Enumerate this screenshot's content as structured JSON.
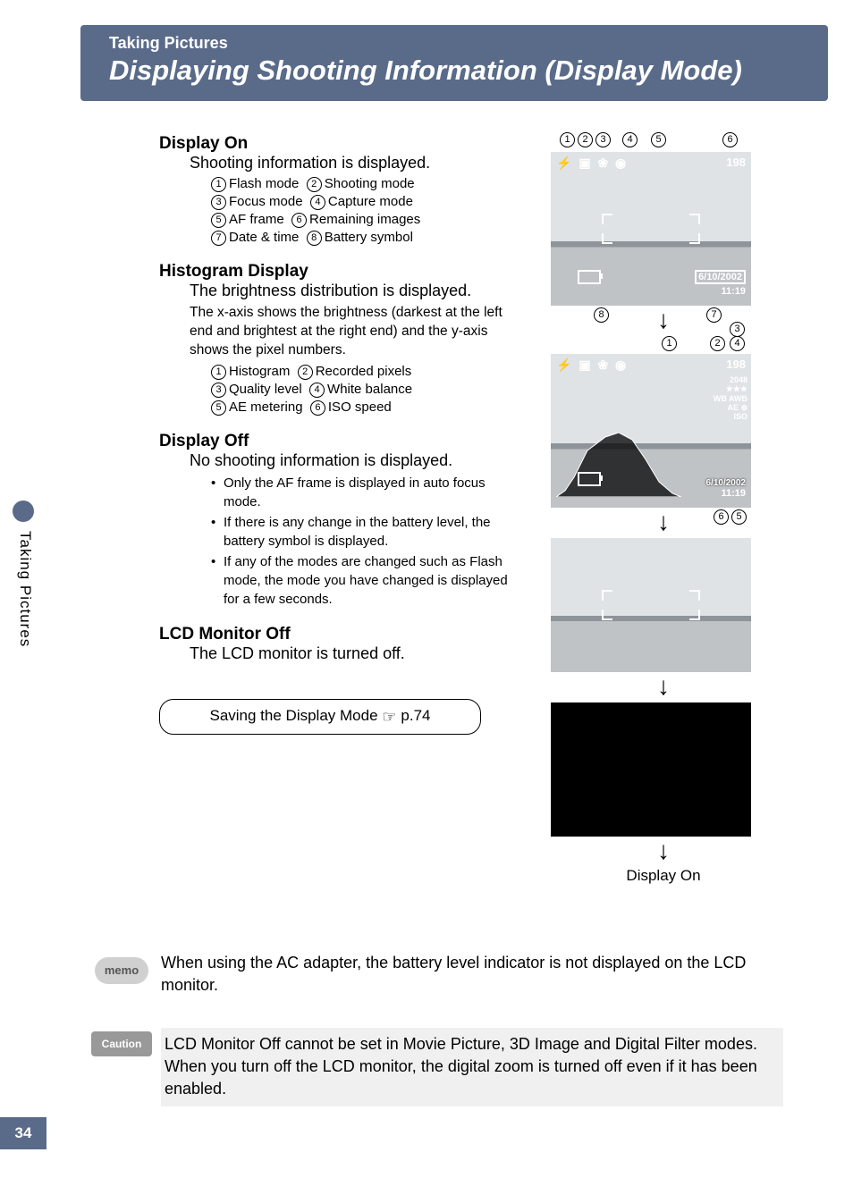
{
  "header": {
    "category": "Taking Pictures",
    "title": "Displaying Shooting Information (Display Mode)"
  },
  "sidebar": {
    "label": "Taking Pictures"
  },
  "page_number": "34",
  "s1": {
    "title": "Display On",
    "lead": "Shooting information is displayed.",
    "items": [
      {
        "n": "1",
        "l": "Flash mode"
      },
      {
        "n": "2",
        "l": "Shooting mode"
      },
      {
        "n": "3",
        "l": "Focus mode"
      },
      {
        "n": "4",
        "l": "Capture mode"
      },
      {
        "n": "5",
        "l": "AF frame"
      },
      {
        "n": "6",
        "l": "Remaining images"
      },
      {
        "n": "7",
        "l": "Date & time"
      },
      {
        "n": "8",
        "l": "Battery symbol"
      }
    ]
  },
  "s2": {
    "title": "Histogram Display",
    "lead": "The brightness distribution is displayed.",
    "body": "The x-axis shows the brightness (darkest at the left end and brightest at the right end) and the y-axis shows the pixel numbers.",
    "items": [
      {
        "n": "1",
        "l": "Histogram"
      },
      {
        "n": "2",
        "l": "Recorded pixels"
      },
      {
        "n": "3",
        "l": "Quality level"
      },
      {
        "n": "4",
        "l": "White balance"
      },
      {
        "n": "5",
        "l": "AE metering"
      },
      {
        "n": "6",
        "l": "ISO speed"
      }
    ]
  },
  "s3": {
    "title": "Display Off",
    "lead": "No shooting information is displayed.",
    "bullets": [
      "Only the AF frame is displayed in auto focus mode.",
      "If there is any change in the battery level, the battery symbol is displayed.",
      "If any of the modes are changed such as  Flash mode, the mode you have changed is displayed for a few seconds."
    ]
  },
  "s4": {
    "title": "LCD Monitor Off",
    "lead": "The LCD monitor is turned off."
  },
  "save": {
    "label": "Saving the Display Mode",
    "ref": "p.74"
  },
  "memo": {
    "label": "memo",
    "text": "When using the AC adapter, the battery level indicator is not displayed on the LCD monitor."
  },
  "caution": {
    "label": "Caution",
    "text": "LCD Monitor Off cannot be set in Movie Picture, 3D Image and Digital Filter modes.\nWhen you turn off the LCD monitor, the digital zoom is turned off even if it has been enabled."
  },
  "lcd1": {
    "icons": "⚡ ▣ ❀ ◉",
    "remain": "198",
    "date": "6/10/2002",
    "time": "11:19",
    "callouts": [
      "1",
      "2",
      "3",
      "4",
      "5",
      "6",
      "7",
      "8"
    ]
  },
  "lcd2": {
    "icons": "⚡ ▣ ❀ ◉",
    "remain": "198",
    "rp": "2048",
    "ql": "★★★",
    "wb": "WB AWB",
    "ae": "AE ⊚",
    "iso": "ISO",
    "date": "6/10/2002",
    "time": "11:19",
    "callouts": [
      "1",
      "2",
      "3",
      "4",
      "5",
      "6"
    ]
  },
  "final_label": "Display On"
}
